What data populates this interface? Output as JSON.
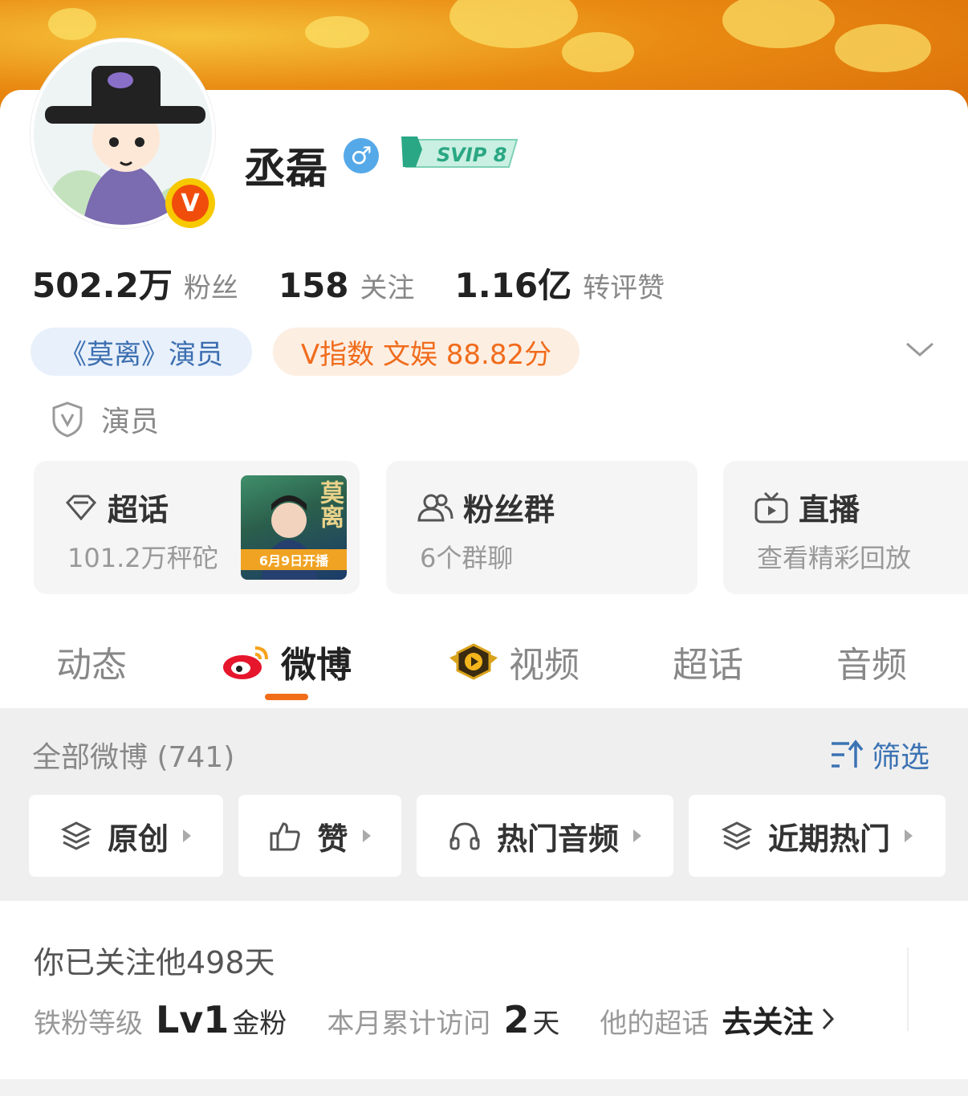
{
  "profile": {
    "name": "丞磊",
    "gender_symbol": "♂",
    "vip_label": "SVIP 8",
    "verified_badge": "V"
  },
  "stats": [
    {
      "value": "502.2万",
      "label": "粉丝"
    },
    {
      "value": "158",
      "label": "关注"
    },
    {
      "value": "1.16亿",
      "label": "转评赞"
    }
  ],
  "tags": {
    "role_tag": "《莫离》演员",
    "v_index": "V指数 文娱 88.82分"
  },
  "certification": "演员",
  "tiles": [
    {
      "title": "超话",
      "subtitle": "101.2万秤砣",
      "thumb_title": "莫离",
      "thumb_banner": "6月9日开播"
    },
    {
      "title": "粉丝群",
      "subtitle": "6个群聊"
    },
    {
      "title": "直播",
      "subtitle": "查看精彩回放"
    }
  ],
  "tabs": [
    {
      "label": "动态"
    },
    {
      "label": "微博"
    },
    {
      "label": "视频"
    },
    {
      "label": "超话"
    },
    {
      "label": "音频"
    }
  ],
  "feed": {
    "title": "全部微博 (741)",
    "filter_label": "筛选",
    "chips": [
      {
        "label": "原创"
      },
      {
        "label": "赞"
      },
      {
        "label": "热门音频"
      },
      {
        "label": "近期热门"
      }
    ]
  },
  "follow_info": {
    "title": "你已关注他498天",
    "fan_level_label": "铁粉等级",
    "fan_level_value": "Lv1",
    "fan_level_unit": "金粉",
    "visits_label": "本月累计访问",
    "visits_value": "2",
    "visits_unit": "天",
    "super_topic_label": "他的超话",
    "super_topic_link": "去关注"
  },
  "colors": {
    "accent_orange": "#f26d1a",
    "link_blue": "#3c73b4",
    "tag_blue_bg": "#e8f0fb",
    "tag_orange_bg": "#fdeee2"
  }
}
